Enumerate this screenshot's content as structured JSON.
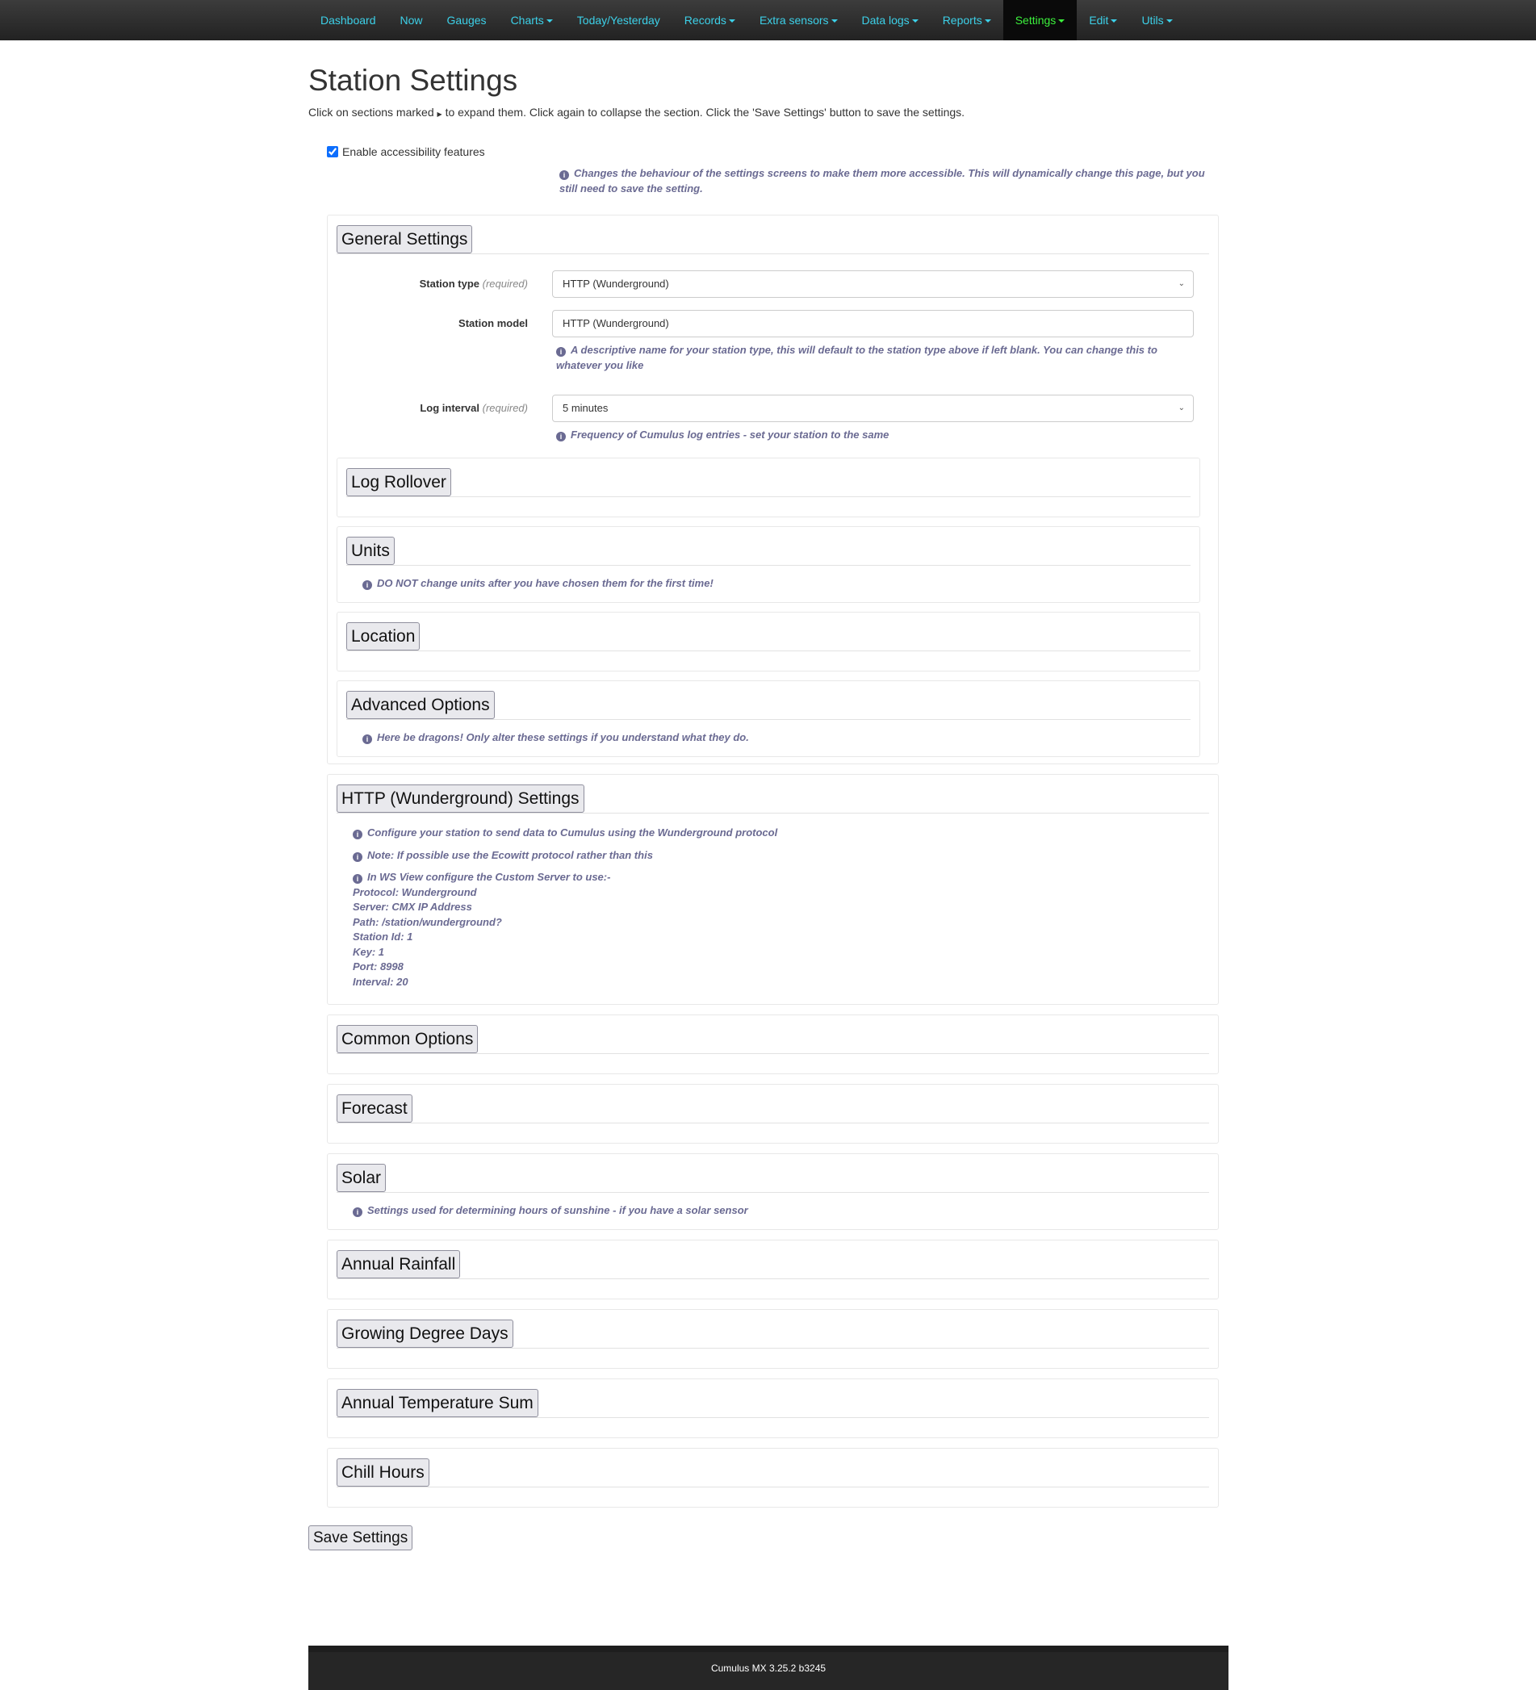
{
  "nav": {
    "items": [
      {
        "label": "Dashboard",
        "dropdown": false
      },
      {
        "label": "Now",
        "dropdown": false
      },
      {
        "label": "Gauges",
        "dropdown": false
      },
      {
        "label": "Charts",
        "dropdown": true
      },
      {
        "label": "Today/Yesterday",
        "dropdown": false
      },
      {
        "label": "Records",
        "dropdown": true
      },
      {
        "label": "Extra sensors",
        "dropdown": true
      },
      {
        "label": "Data logs",
        "dropdown": true
      },
      {
        "label": "Reports",
        "dropdown": true
      },
      {
        "label": "Settings",
        "dropdown": true,
        "active": true
      },
      {
        "label": "Edit",
        "dropdown": true
      },
      {
        "label": "Utils",
        "dropdown": true
      }
    ],
    "link_color": "#3cd0e8",
    "active_color": "#3cf03c"
  },
  "page": {
    "title": "Station Settings",
    "intro_a": "Click on sections marked",
    "intro_b": "to expand them. Click again to collapse the section. Click the 'Save Settings' button to save the settings."
  },
  "accessibility": {
    "label": "Enable accessibility features",
    "checked": true,
    "help": "Changes the behaviour of the settings screens to make them more accessible. This will dynamically change this page, but you still need to save the setting."
  },
  "general": {
    "title": "General Settings",
    "station_type": {
      "label": "Station type",
      "req": "(required)",
      "value": "HTTP (Wunderground)"
    },
    "station_model": {
      "label": "Station model",
      "value": "HTTP (Wunderground)",
      "help": "A descriptive name for your station type, this will default to the station type above if left blank. You can change this to whatever you like"
    },
    "log_interval": {
      "label": "Log interval",
      "req": "(required)",
      "value": "5 minutes",
      "help": "Frequency of Cumulus log entries - set your station to the same"
    },
    "log_rollover": {
      "title": "Log Rollover"
    },
    "units": {
      "title": "Units",
      "help": "DO NOT change units after you have chosen them for the first time!"
    },
    "location": {
      "title": "Location"
    },
    "advanced": {
      "title": "Advanced Options",
      "help": "Here be dragons! Only alter these settings if you understand what they do."
    }
  },
  "http": {
    "title": "HTTP (Wunderground) Settings",
    "help1": "Configure your station to send data to Cumulus using the Wunderground protocol",
    "help2": "Note: If possible use the Ecowitt protocol rather than this",
    "help3": "In WS View configure the Custom Server to use:-",
    "lines": [
      "Protocol: Wunderground",
      "Server: CMX IP Address",
      "Path: /station/wunderground?",
      "Station Id: 1",
      "Key: 1",
      "Port: 8998",
      "Interval: 20"
    ]
  },
  "sections": {
    "common": "Common Options",
    "forecast": "Forecast",
    "solar": "Solar",
    "solar_help": "Settings used for determining hours of sunshine - if you have a solar sensor",
    "rainfall": "Annual Rainfall",
    "gdd": "Growing Degree Days",
    "ats": "Annual Temperature Sum",
    "chill": "Chill Hours"
  },
  "save_label": "Save Settings",
  "footer": "Cumulus MX 3.25.2 b3245"
}
